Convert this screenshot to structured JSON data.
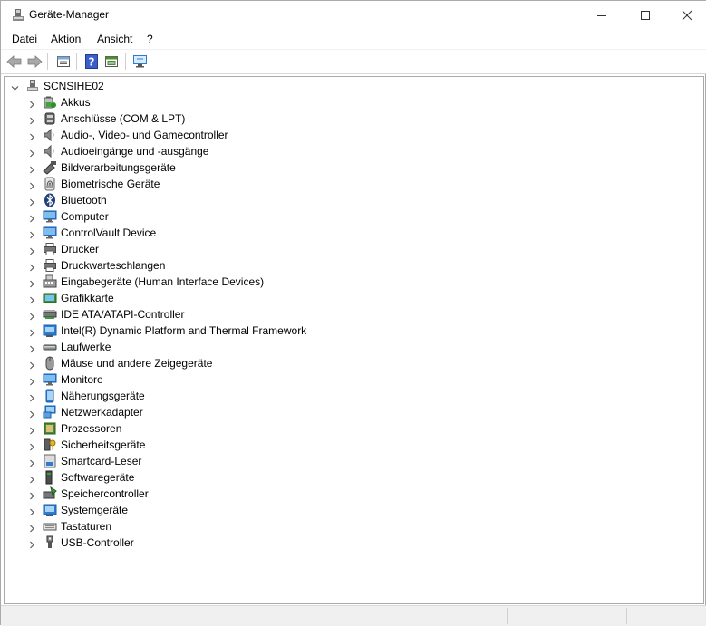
{
  "window": {
    "title": "Geräte-Manager"
  },
  "menu": {
    "file": "Datei",
    "action": "Aktion",
    "view": "Ansicht",
    "help": "?"
  },
  "toolbar": {
    "icons": [
      "back-arrow-icon",
      "forward-arrow-icon",
      "properties-icon",
      "help-icon",
      "update-driver-icon",
      "scan-hardware-icon"
    ]
  },
  "tree": {
    "root": "SCNSIHE02",
    "categories": [
      {
        "label": "Akkus",
        "icon": "battery-icon"
      },
      {
        "label": "Anschlüsse (COM & LPT)",
        "icon": "port-icon"
      },
      {
        "label": "Audio-, Video- und Gamecontroller",
        "icon": "speaker-icon"
      },
      {
        "label": "Audioeingänge und -ausgänge",
        "icon": "speaker-icon"
      },
      {
        "label": "Bildverarbeitungsgeräte",
        "icon": "camera-icon"
      },
      {
        "label": "Biometrische Geräte",
        "icon": "fingerprint-icon"
      },
      {
        "label": "Bluetooth",
        "icon": "bluetooth-icon"
      },
      {
        "label": "Computer",
        "icon": "monitor-icon"
      },
      {
        "label": "ControlVault Device",
        "icon": "monitor-icon"
      },
      {
        "label": "Drucker",
        "icon": "printer-icon"
      },
      {
        "label": "Druckwarteschlangen",
        "icon": "printer-icon"
      },
      {
        "label": "Eingabegeräte (Human Interface Devices)",
        "icon": "hid-icon"
      },
      {
        "label": "Grafikkarte",
        "icon": "display-adapter-icon"
      },
      {
        "label": "IDE ATA/ATAPI-Controller",
        "icon": "ide-controller-icon"
      },
      {
        "label": "Intel(R) Dynamic Platform and Thermal Framework",
        "icon": "system-device-icon"
      },
      {
        "label": "Laufwerke",
        "icon": "drive-icon"
      },
      {
        "label": "Mäuse und andere Zeigegeräte",
        "icon": "mouse-icon"
      },
      {
        "label": "Monitore",
        "icon": "monitor-icon"
      },
      {
        "label": "Näherungsgeräte",
        "icon": "phone-icon"
      },
      {
        "label": "Netzwerkadapter",
        "icon": "network-adapter-icon"
      },
      {
        "label": "Prozessoren",
        "icon": "processor-icon"
      },
      {
        "label": "Sicherheitsgeräte",
        "icon": "security-key-icon"
      },
      {
        "label": "Smartcard-Leser",
        "icon": "smartcard-icon"
      },
      {
        "label": "Softwaregeräte",
        "icon": "software-device-icon"
      },
      {
        "label": "Speichercontroller",
        "icon": "storage-controller-icon"
      },
      {
        "label": "Systemgeräte",
        "icon": "system-device-icon"
      },
      {
        "label": "Tastaturen",
        "icon": "keyboard-icon"
      },
      {
        "label": "USB-Controller",
        "icon": "usb-icon"
      }
    ]
  },
  "colors": {
    "accent": "#2b7cd3",
    "chevron": "#5a5a5a",
    "border": "#a9a9a9",
    "statusbar": "#f0f0f0"
  }
}
